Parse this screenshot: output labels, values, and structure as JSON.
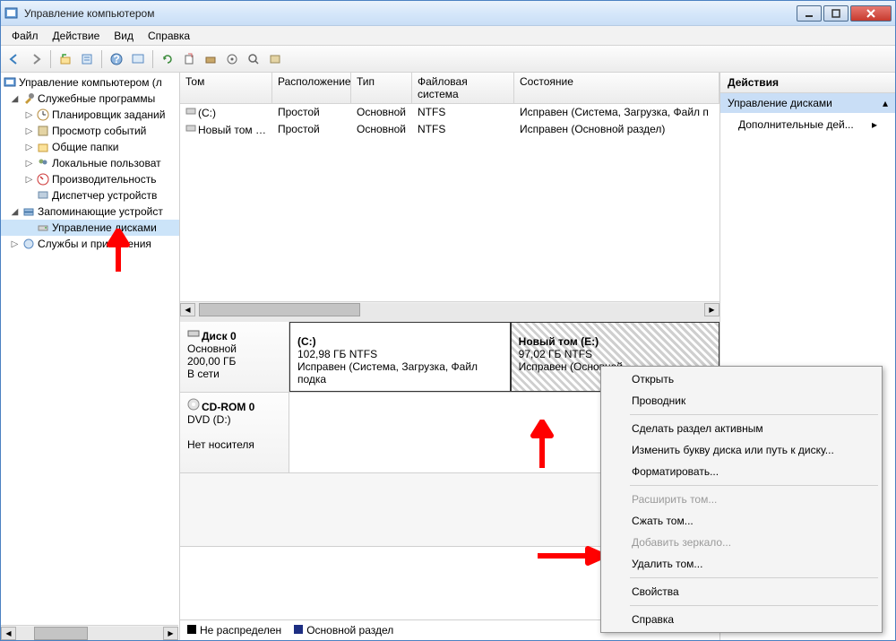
{
  "window": {
    "title": "Управление компьютером"
  },
  "menubar": [
    "Файл",
    "Действие",
    "Вид",
    "Справка"
  ],
  "tree": {
    "root": "Управление компьютером (л",
    "groups": [
      {
        "label": "Служебные программы",
        "items": [
          "Планировщик заданий",
          "Просмотр событий",
          "Общие папки",
          "Локальные пользоват",
          "Производительность",
          "Диспетчер устройств"
        ]
      },
      {
        "label": "Запоминающие устройст",
        "items": [
          "Управление дисками"
        ]
      },
      {
        "label": "Службы и приложения",
        "items": []
      }
    ]
  },
  "volumes": {
    "headers": {
      "vol": "Том",
      "layout": "Расположение",
      "type": "Тип",
      "fs": "Файловая система",
      "status": "Состояние"
    },
    "rows": [
      {
        "vol": "(C:)",
        "layout": "Простой",
        "type": "Основной",
        "fs": "NTFS",
        "status": "Исправен (Система, Загрузка, Файл п"
      },
      {
        "vol": "Новый том (E:)",
        "layout": "Простой",
        "type": "Основной",
        "fs": "NTFS",
        "status": "Исправен (Основной раздел)"
      }
    ]
  },
  "disks": [
    {
      "name": "Диск 0",
      "type": "Основной",
      "size": "200,00 ГБ",
      "status": "В сети",
      "partitions": [
        {
          "name": "(C:)",
          "size": "102,98 ГБ NTFS",
          "status": "Исправен (Система, Загрузка, Файл подка",
          "hatched": false
        },
        {
          "name": "Новый том  (E:)",
          "size": "97,02 ГБ NTFS",
          "status": "Исправен (Основной",
          "hatched": true
        }
      ]
    },
    {
      "name": "CD-ROM 0",
      "type": "DVD (D:)",
      "size": "",
      "status": "Нет носителя",
      "partitions": []
    }
  ],
  "legend": {
    "unalloc": "Не распределен",
    "primary": "Основной раздел"
  },
  "actions": {
    "header": "Действия",
    "section": "Управление дисками",
    "item": "Дополнительные дей..."
  },
  "context_menu": [
    {
      "label": "Открыть",
      "enabled": true
    },
    {
      "label": "Проводник",
      "enabled": true
    },
    {
      "sep": true
    },
    {
      "label": "Сделать раздел активным",
      "enabled": true
    },
    {
      "label": "Изменить букву диска или путь к диску...",
      "enabled": true
    },
    {
      "label": "Форматировать...",
      "enabled": true
    },
    {
      "sep": true
    },
    {
      "label": "Расширить том...",
      "enabled": false
    },
    {
      "label": "Сжать том...",
      "enabled": true
    },
    {
      "label": "Добавить зеркало...",
      "enabled": false
    },
    {
      "label": "Удалить том...",
      "enabled": true
    },
    {
      "sep": true
    },
    {
      "label": "Свойства",
      "enabled": true
    },
    {
      "sep": true
    },
    {
      "label": "Справка",
      "enabled": true
    }
  ]
}
